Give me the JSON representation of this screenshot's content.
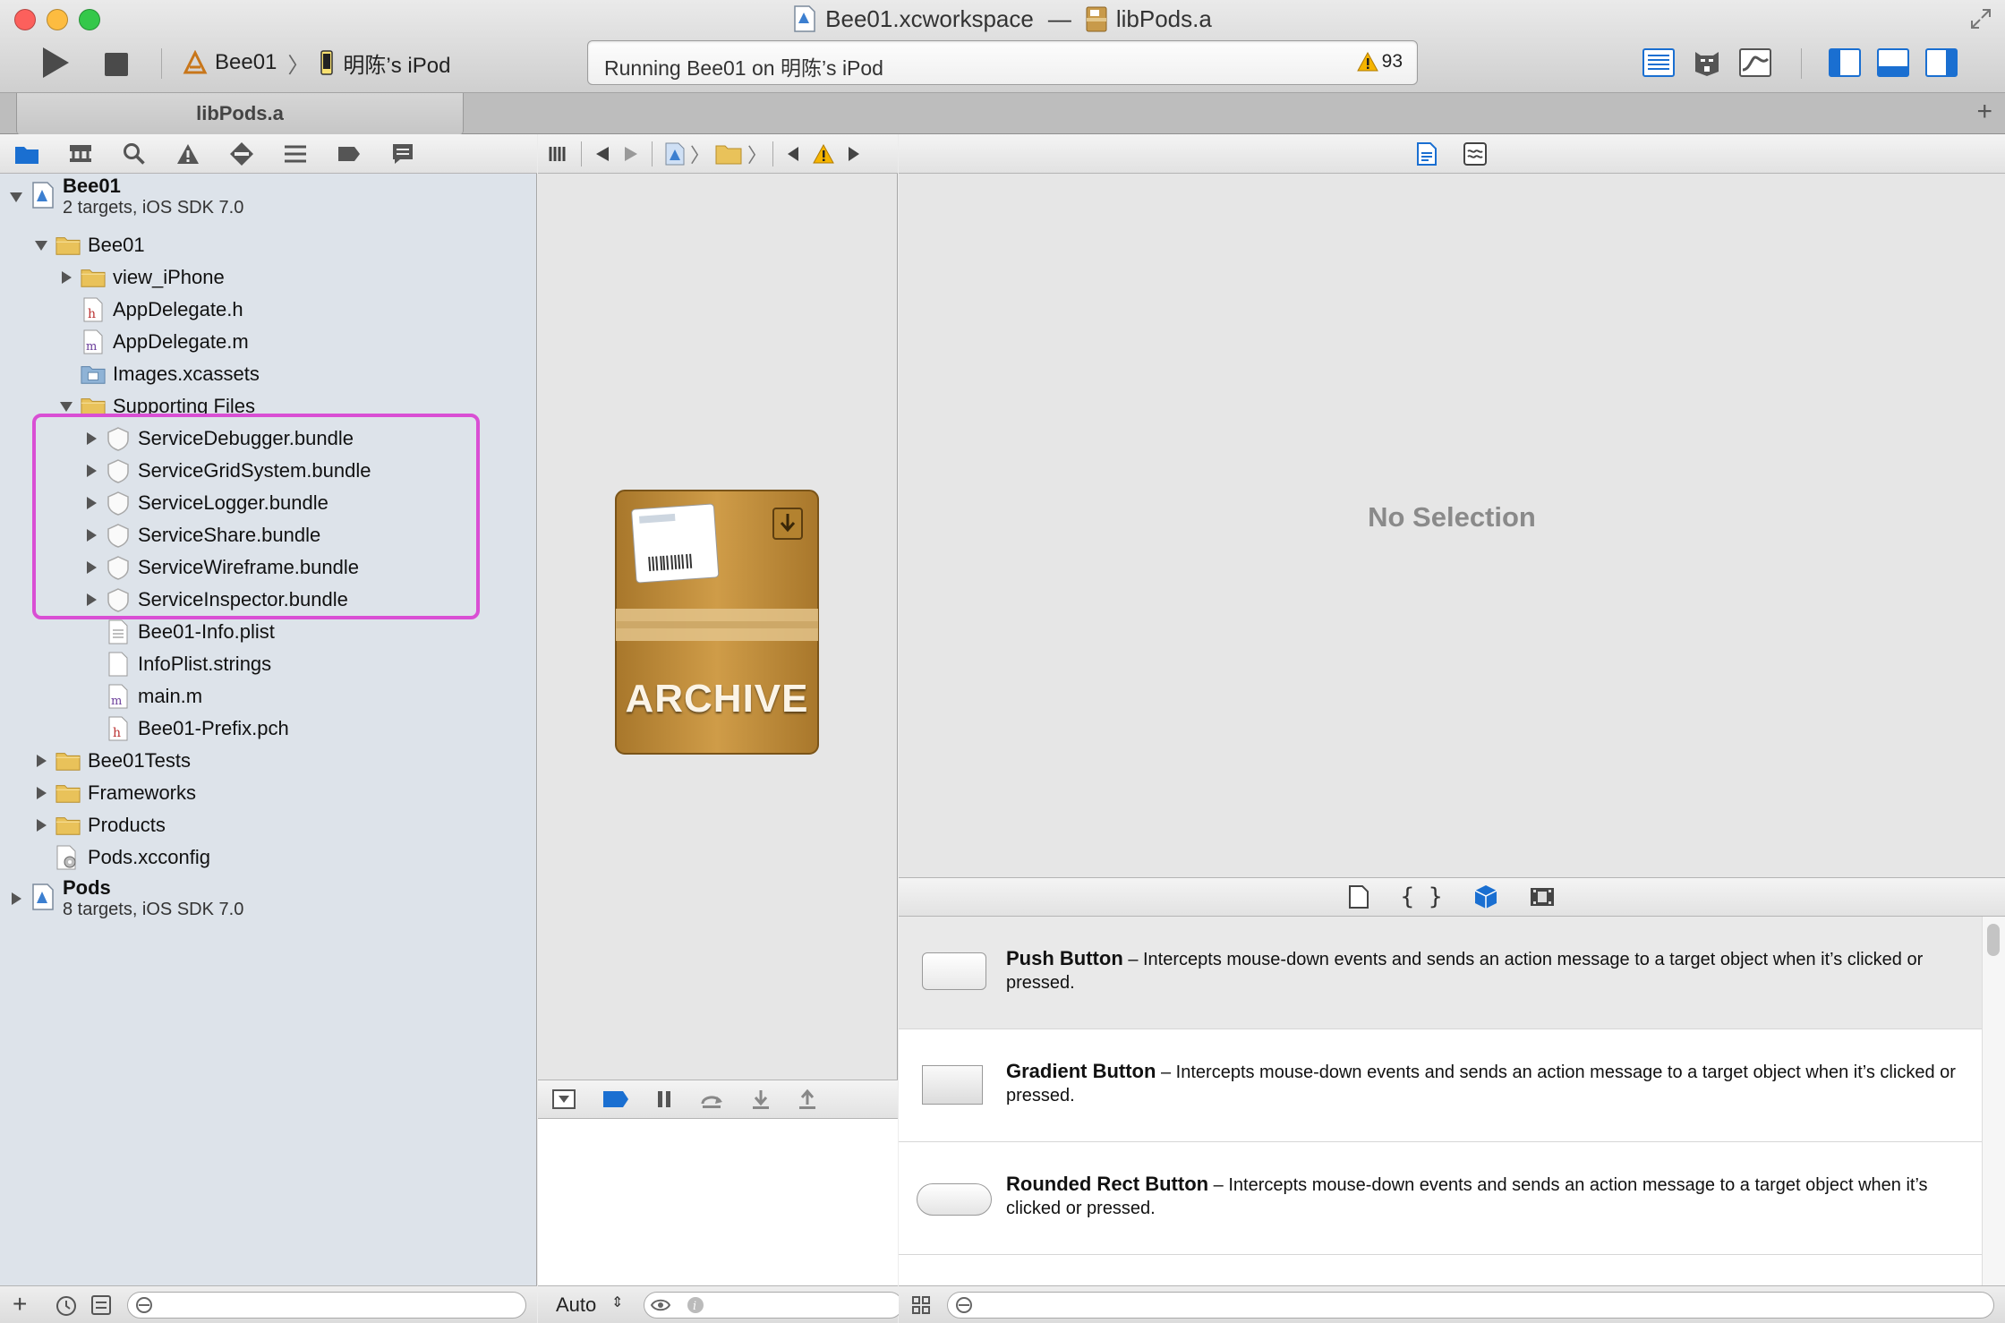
{
  "window": {
    "workspace_title": "Bee01.xcworkspace",
    "separator": "—",
    "file_title": "libPods.a",
    "traffic_colors": [
      "#fc605c",
      "#fdbc40",
      "#34c84a"
    ]
  },
  "toolbar": {
    "scheme": "Bee01",
    "device": "明陈’s iPod",
    "activity_text": "Running Bee01 on 明陈’s iPod",
    "warning_count": "93"
  },
  "tab": {
    "label": "libPods.a",
    "add_label": "+"
  },
  "navigator": {
    "items": [
      {
        "label": "Bee01",
        "subtitle": "2 targets, iOS SDK 7.0",
        "icon": "project-icon",
        "expanded": true
      },
      {
        "label": "Bee01",
        "icon": "folder-icon",
        "expanded": true
      },
      {
        "label": "view_iPhone",
        "icon": "folder-icon",
        "expanded": false
      },
      {
        "label": "AppDelegate.h",
        "icon": "header-file-icon"
      },
      {
        "label": "AppDelegate.m",
        "icon": "m-file-icon"
      },
      {
        "label": "Images.xcassets",
        "icon": "asset-catalog-icon"
      },
      {
        "label": "Supporting Files",
        "icon": "folder-icon",
        "expanded": true
      },
      {
        "label": "ServiceDebugger.bundle",
        "icon": "bundle-icon",
        "expanded": false
      },
      {
        "label": "ServiceGridSystem.bundle",
        "icon": "bundle-icon",
        "expanded": false
      },
      {
        "label": "ServiceLogger.bundle",
        "icon": "bundle-icon",
        "expanded": false
      },
      {
        "label": "ServiceShare.bundle",
        "icon": "bundle-icon",
        "expanded": false
      },
      {
        "label": "ServiceWireframe.bundle",
        "icon": "bundle-icon",
        "expanded": false
      },
      {
        "label": "ServiceInspector.bundle",
        "icon": "bundle-icon",
        "expanded": false
      },
      {
        "label": "Bee01-Info.plist",
        "icon": "plist-icon"
      },
      {
        "label": "InfoPlist.strings",
        "icon": "strings-file-icon"
      },
      {
        "label": "main.m",
        "icon": "m-file-icon"
      },
      {
        "label": "Bee01-Prefix.pch",
        "icon": "header-file-icon"
      },
      {
        "label": "Bee01Tests",
        "icon": "folder-icon",
        "expanded": false
      },
      {
        "label": "Frameworks",
        "icon": "folder-icon",
        "expanded": false
      },
      {
        "label": "Products",
        "icon": "folder-icon",
        "expanded": false
      },
      {
        "label": "Pods.xcconfig",
        "icon": "xcconfig-icon"
      },
      {
        "label": "Pods",
        "subtitle": "8 targets, iOS SDK 7.0",
        "icon": "project-icon",
        "expanded": false
      }
    ],
    "footer_add": "+"
  },
  "editor": {
    "archive_label": "ARCHIVE",
    "console_mode": "Auto"
  },
  "inspector": {
    "no_selection": "No Selection"
  },
  "library": {
    "items": [
      {
        "name": "Push Button",
        "desc": " – Intercepts mouse-down events and sends an action message to a target object when it’s clicked or pressed."
      },
      {
        "name": "Gradient Button",
        "desc": " – Intercepts mouse-down events and sends an action message to a target object when it’s clicked or pressed."
      },
      {
        "name": "Rounded Rect Button",
        "desc": " – Intercepts mouse-down events and sends an action message to a target object when it’s clicked or pressed."
      }
    ]
  },
  "colors": {
    "highlight_box": "#d94fd4",
    "folder_yellow": "#e9c25a",
    "warning_yellow": "#f5b400",
    "accent_blue": "#1a6fd1"
  }
}
